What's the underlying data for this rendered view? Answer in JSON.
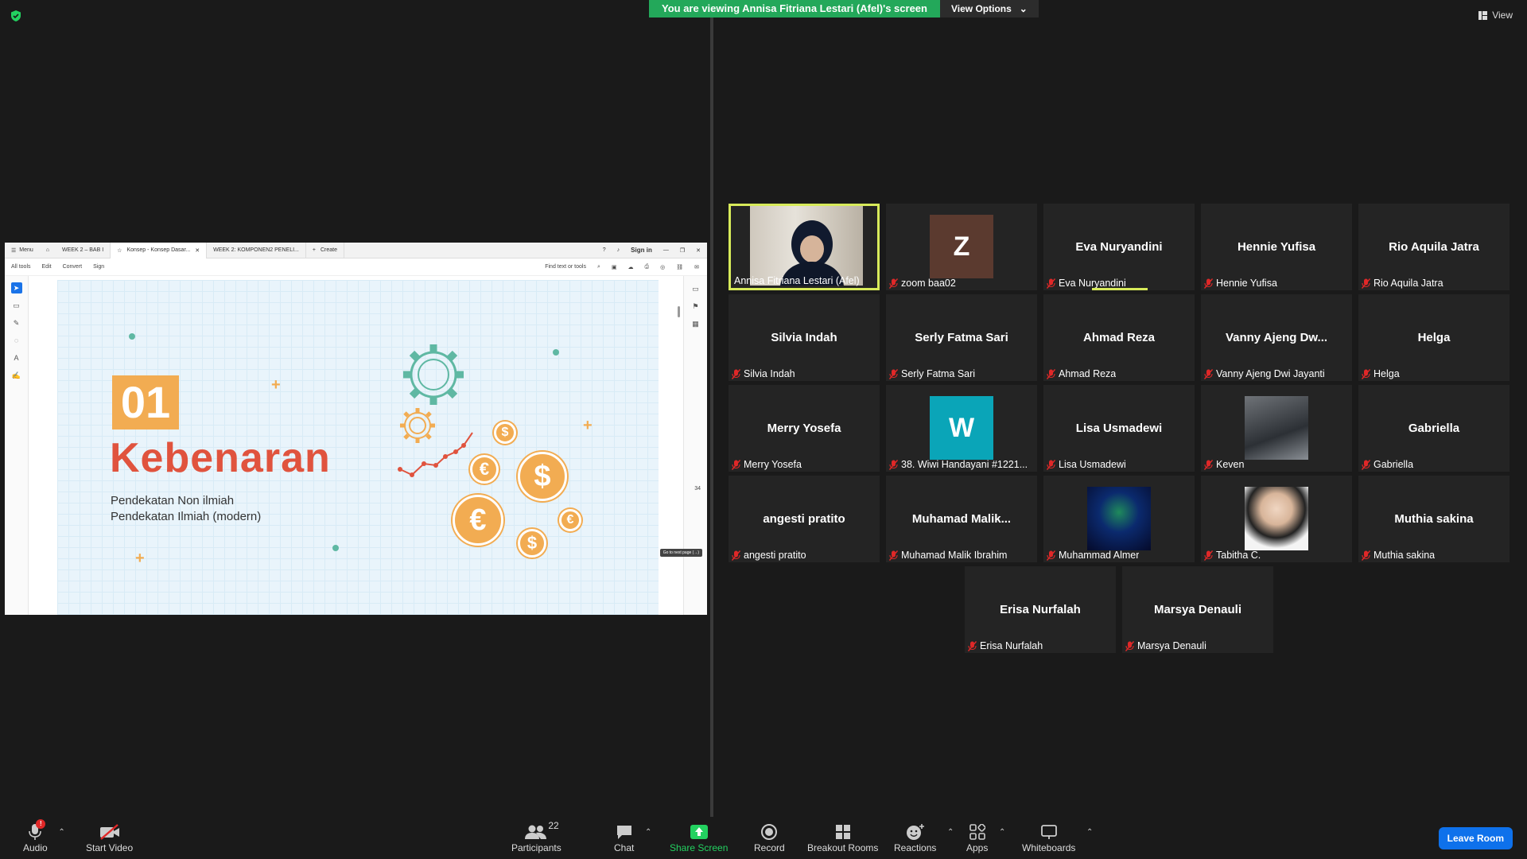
{
  "banner": {
    "viewing_text": "You are viewing Annisa Fitriana Lestari (Afel)'s screen",
    "view_options": "View Options"
  },
  "top_view": "View",
  "shared_screen": {
    "tabbar": {
      "menu": "Menu",
      "tab1": "WEEK 2 – BAB I",
      "tab2": "Konsep - Konsep Dasar...",
      "tab3": "WEEK 2: KOMPONEN2 PENELI...",
      "create": "Create",
      "sign_in": "Sign in"
    },
    "menubar": {
      "all_tools": "All tools",
      "edit": "Edit",
      "convert": "Convert",
      "sign": "Sign",
      "find": "Find text or tools"
    },
    "page_number": "34",
    "tooltip": "Go to next page (→)",
    "slide": {
      "number": "01",
      "title": "Kebenaran",
      "line1": "Pendekatan Non ilmiah",
      "line2": "Pendekatan Ilmiah (modern)"
    }
  },
  "participants": [
    {
      "name": "Annisa Fitriana Lestari (Afel)",
      "display": "",
      "type": "video",
      "muted": false,
      "active": true
    },
    {
      "name": "zoom baa02",
      "display": "Z",
      "type": "avatar",
      "color": "#5b3a2f",
      "muted": true
    },
    {
      "name": "Eva Nuryandini",
      "display": "Eva Nuryandini",
      "type": "name",
      "muted": true,
      "speaking": true
    },
    {
      "name": "Hennie Yufisa",
      "display": "Hennie Yufisa",
      "type": "name",
      "muted": true
    },
    {
      "name": "Rio Aquila Jatra",
      "display": "Rio Aquila Jatra",
      "type": "name",
      "muted": true
    },
    {
      "name": "Silvia Indah",
      "display": "Silvia Indah",
      "type": "name",
      "muted": true
    },
    {
      "name": "Serly Fatma Sari",
      "display": "Serly Fatma Sari",
      "type": "name",
      "muted": true
    },
    {
      "name": "Ahmad Reza",
      "display": "Ahmad Reza",
      "type": "name",
      "muted": true
    },
    {
      "name": "Vanny Ajeng Dwi Jayanti",
      "display": "Vanny  Ajeng  Dw...",
      "type": "name",
      "muted": true
    },
    {
      "name": "Helga",
      "display": "Helga",
      "type": "name",
      "muted": true
    },
    {
      "name": "Merry Yosefa",
      "display": "Merry Yosefa",
      "type": "name",
      "muted": true
    },
    {
      "name": "38. Wiwi Handayani #1221...",
      "display": "W",
      "type": "avatar",
      "color": "#0aa5b8",
      "muted": true
    },
    {
      "name": "Lisa Usmadewi",
      "display": "Lisa Usmadewi",
      "type": "name",
      "muted": true
    },
    {
      "name": "Keven",
      "display": "",
      "type": "photo",
      "muted": true
    },
    {
      "name": "Gabriella",
      "display": "Gabriella",
      "type": "name",
      "muted": true
    },
    {
      "name": "angesti pratito",
      "display": "angesti pratito",
      "type": "name",
      "muted": true
    },
    {
      "name": "Muhamad Malik Ibrahim",
      "display": "Muhamad  Malik...",
      "type": "name",
      "muted": true
    },
    {
      "name": "Muhammad Almer",
      "display": "",
      "type": "photo",
      "muted": true
    },
    {
      "name": "Tabitha C.",
      "display": "",
      "type": "photo",
      "muted": true
    },
    {
      "name": "Muthia sakina",
      "display": "Muthia sakina",
      "type": "name",
      "muted": true
    },
    {
      "name": "Erisa Nurfalah",
      "display": "Erisa Nurfalah",
      "type": "name",
      "muted": true
    },
    {
      "name": "Marsya Denauli",
      "display": "Marsya Denauli",
      "type": "name",
      "muted": true
    }
  ],
  "toolbar": {
    "audio": "Audio",
    "start_video": "Start Video",
    "participants": "Participants",
    "participant_count": "22",
    "chat": "Chat",
    "share_screen": "Share Screen",
    "record": "Record",
    "breakout_rooms": "Breakout Rooms",
    "reactions": "Reactions",
    "apps": "Apps",
    "whiteboards": "Whiteboards",
    "leave_room": "Leave Room"
  },
  "colors": {
    "accent_green": "#23a85a",
    "active_border": "#d7ea5a",
    "leave_blue": "#0e71eb",
    "tile_bg": "#242424"
  }
}
